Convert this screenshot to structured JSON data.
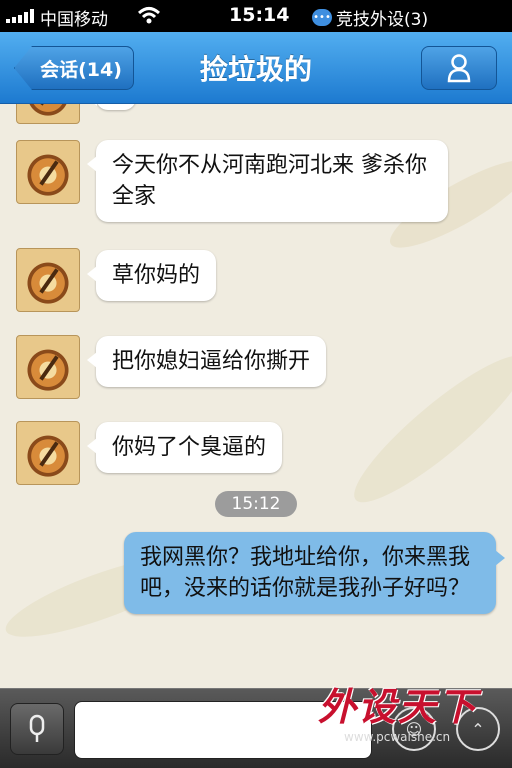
{
  "statusbar": {
    "carrier": "中国移动",
    "time": "15:14",
    "notification": "竞技外设(3)"
  },
  "navbar": {
    "back_label": "会话(14)",
    "title": "捡垃圾的"
  },
  "messages": [
    {
      "side": "in",
      "text": "今天你不从河南跑河北来 爹杀你全家"
    },
    {
      "side": "in",
      "text": "草你妈的"
    },
    {
      "side": "in",
      "text": "把你媳妇逼给你撕开"
    },
    {
      "side": "in",
      "text": "你妈了个臭逼的"
    },
    {
      "side": "out",
      "text": "我网黑你？我地址给你，你来黑我吧，没来的话你就是我孙子好吗？"
    }
  ],
  "timestamp": "15:12",
  "watermark": {
    "logo": "外设天下",
    "url": "www.pcwaishe.cn"
  },
  "colors": {
    "navbar": "#2f8ade",
    "outgoing_bubble": "#7fbbe8",
    "incoming_bubble": "#ffffff",
    "chat_background": "#f0ece0"
  }
}
